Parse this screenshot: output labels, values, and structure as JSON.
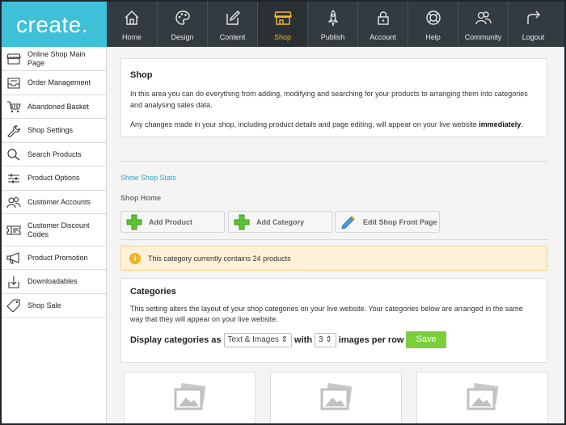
{
  "brand": {
    "logo": "create."
  },
  "topnav": [
    {
      "label": "Home",
      "icon": "home-icon"
    },
    {
      "label": "Design",
      "icon": "palette-icon"
    },
    {
      "label": "Content",
      "icon": "edit-icon"
    },
    {
      "label": "Shop",
      "icon": "shop-icon",
      "active": true
    },
    {
      "label": "Publish",
      "icon": "rocket-icon"
    },
    {
      "label": "Account",
      "icon": "lock-icon"
    },
    {
      "label": "Help",
      "icon": "lifebuoy-icon"
    },
    {
      "label": "Community",
      "icon": "community-icon"
    },
    {
      "label": "Logout",
      "icon": "logout-icon"
    }
  ],
  "sidebar": [
    {
      "label": "Online Shop Main Page",
      "icon": "shop-icon"
    },
    {
      "label": "Order Management",
      "icon": "inbox-icon"
    },
    {
      "label": "Abandoned Basket",
      "icon": "basket-icon"
    },
    {
      "label": "Shop Settings",
      "icon": "wrench-icon"
    },
    {
      "label": "Search Products",
      "icon": "search-icon"
    },
    {
      "label": "Product Options",
      "icon": "sliders-icon"
    },
    {
      "label": "Customer Accounts",
      "icon": "users-icon"
    },
    {
      "label": "Customer Discount Codes",
      "icon": "ticket-icon"
    },
    {
      "label": "Product Promotion",
      "icon": "megaphone-icon"
    },
    {
      "label": "Downloadables",
      "icon": "download-icon"
    },
    {
      "label": "Shop Sale",
      "icon": "tag-icon"
    }
  ],
  "intro": {
    "title": "Shop",
    "p1": "In this area you can do everything from adding, modifying and searching for your products to arranging them into categories and analysing sales data.",
    "p2_before": "Any changes made in your shop, including product details and page editing, will appear on your live website ",
    "p2_bold": "immediately",
    "p2_after": "."
  },
  "links": {
    "show_stats": "Show Shop Stats",
    "shop_home": "Shop Home"
  },
  "buttons": {
    "add_product": "Add Product",
    "add_category": "Add Category",
    "edit_front": "Edit Shop Front Page"
  },
  "notice": {
    "icon_text": "i",
    "text": "This category currently contains 24 products"
  },
  "categories": {
    "title": "Categories",
    "description": "This setting alters the layout of your shop categories on your live website. Your categories below are arranged in the same way that they will appear on your live website.",
    "display_label": "Display categories as",
    "display_value": "Text & Images",
    "with_label": "with",
    "per_row_value": "3",
    "per_row_label": "images per row",
    "save": "Save"
  },
  "colors": {
    "accent": "#3fc0d9",
    "active_nav": "#f2b632",
    "nav_bg": "#343b40",
    "save": "#7ccf3a",
    "notice_bg": "#fdf1d8",
    "link": "#2aa6c7"
  }
}
